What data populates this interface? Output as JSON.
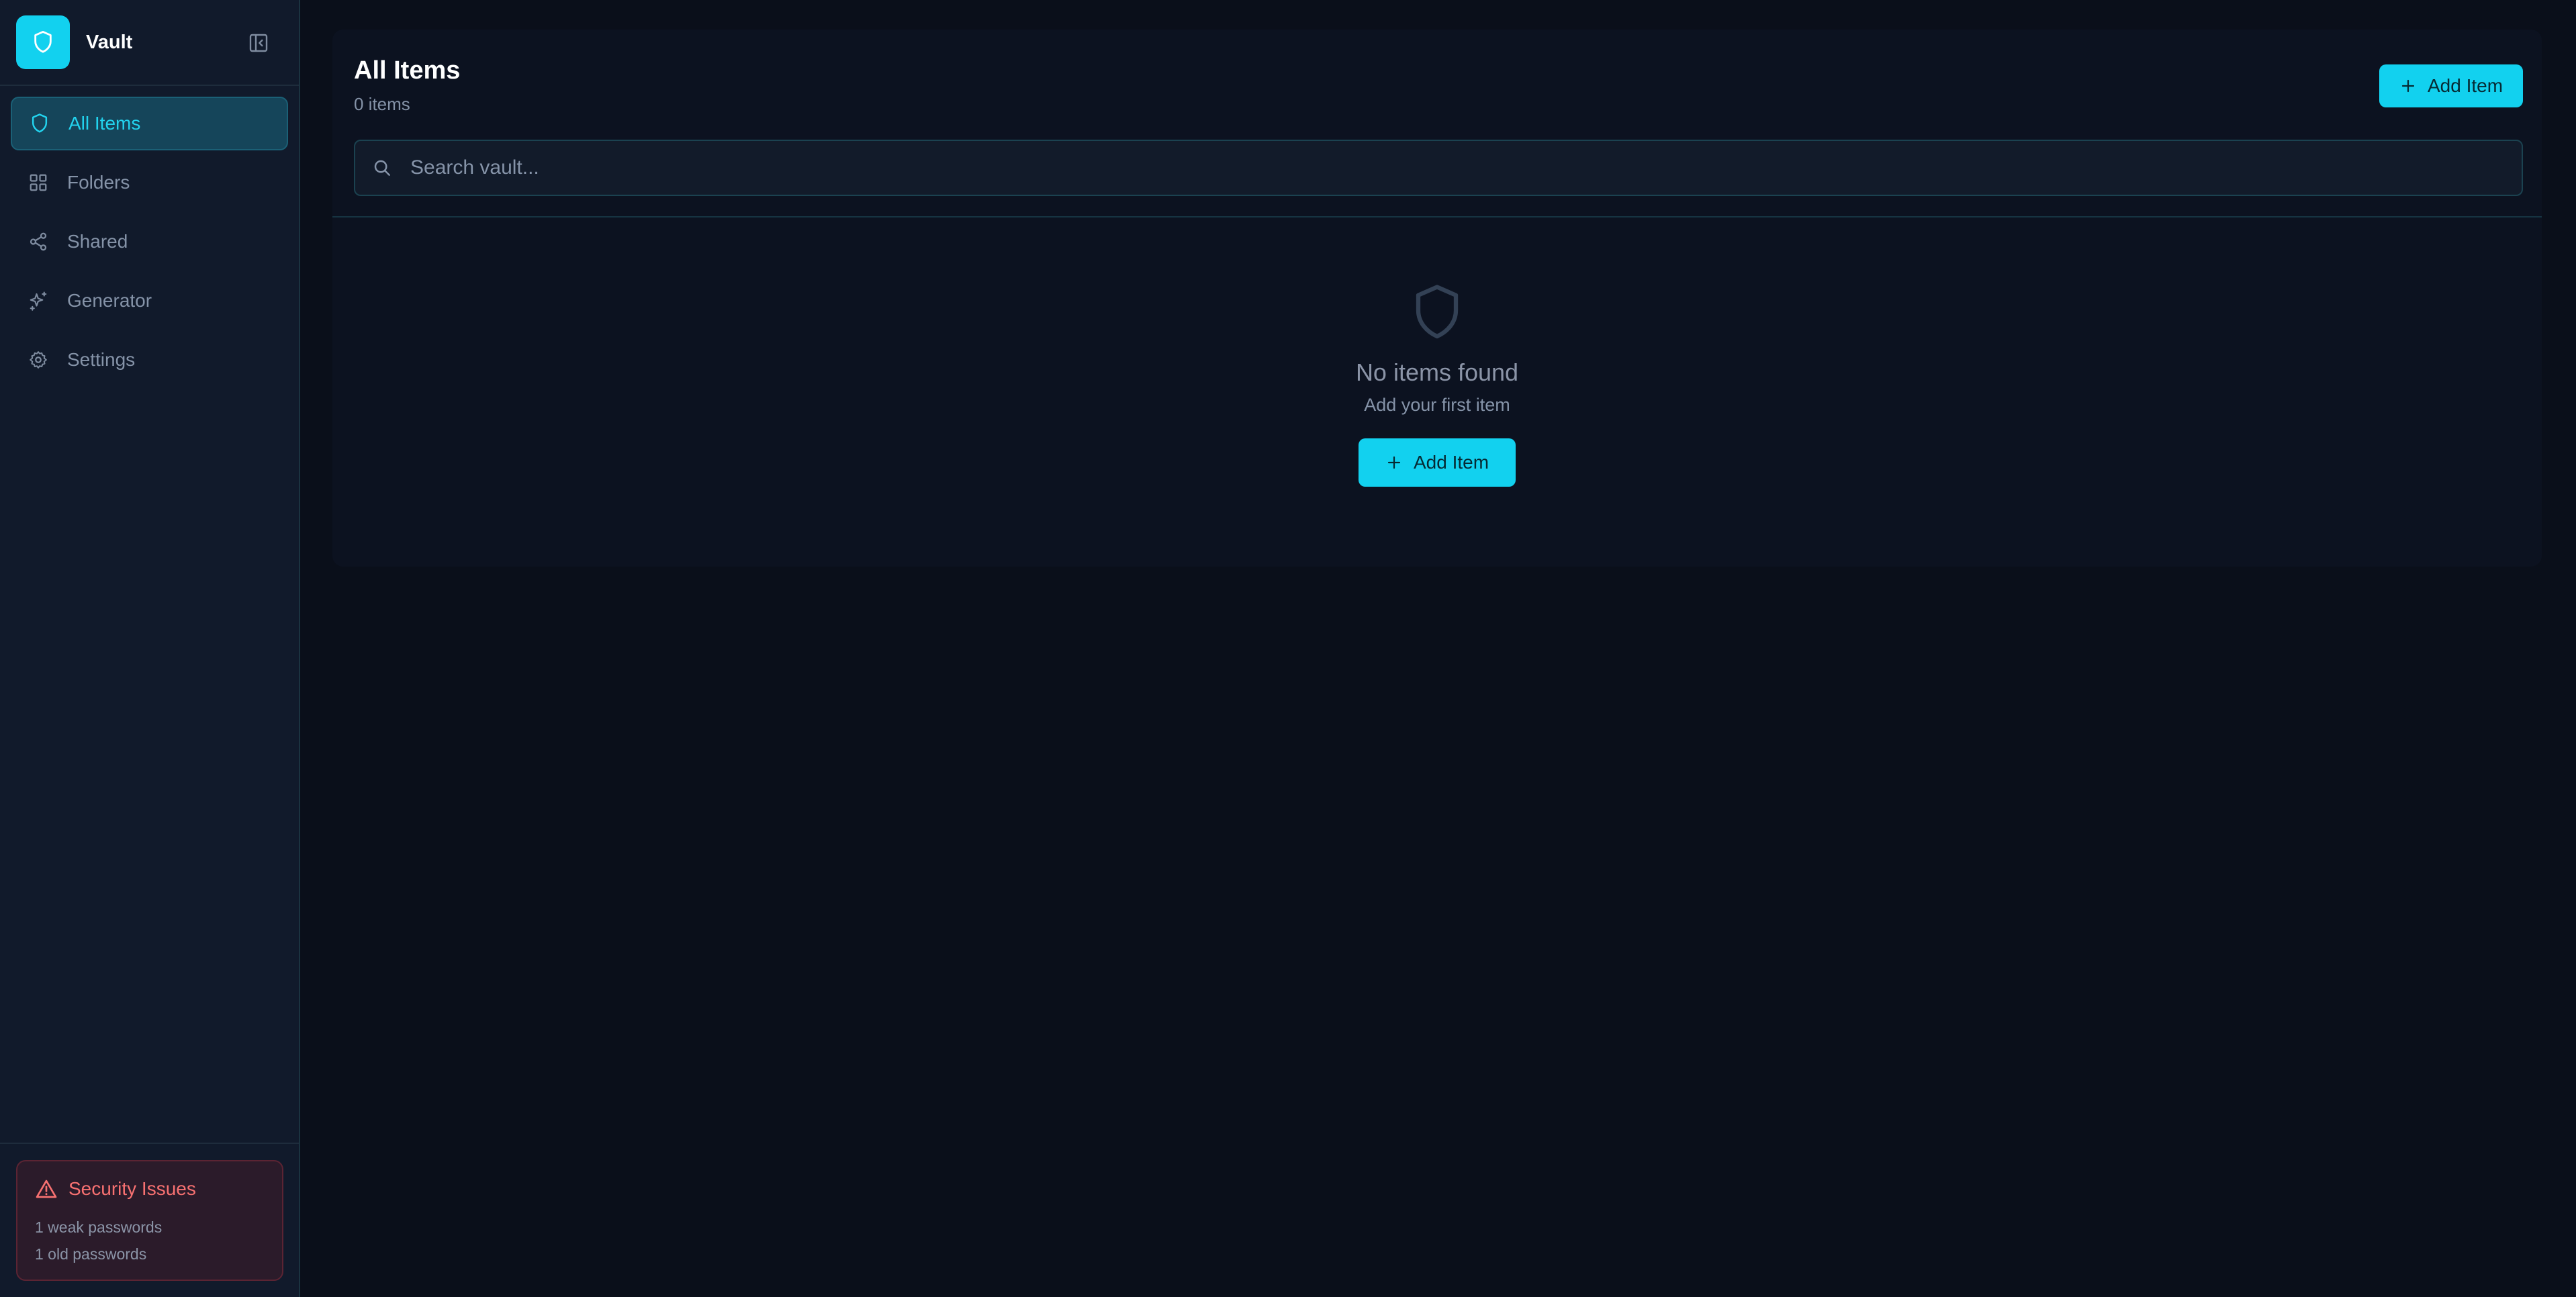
{
  "app": {
    "name": "Vault",
    "brand_color": "#12d1ef",
    "logo_icon": "shield-icon",
    "collapse_icon": "sidebar-collapse-icon"
  },
  "sidebar": {
    "items": [
      {
        "label": "All Items",
        "icon": "shield-icon",
        "active": true
      },
      {
        "label": "Folders",
        "icon": "grid-icon",
        "active": false
      },
      {
        "label": "Shared",
        "icon": "share-icon",
        "active": false
      },
      {
        "label": "Generator",
        "icon": "sparkles-icon",
        "active": false
      },
      {
        "label": "Settings",
        "icon": "gear-icon",
        "active": false
      }
    ],
    "security": {
      "title": "Security Issues",
      "icon": "warning-icon",
      "lines": [
        "1 weak passwords",
        "1 old passwords"
      ],
      "color": "#f87171"
    }
  },
  "main": {
    "title": "All Items",
    "count": "0 items",
    "add_button_label": "Add Item",
    "search_placeholder": "Search vault...",
    "search_value": "",
    "empty": {
      "icon": "shield-icon",
      "title": "No items found",
      "subtitle": "Add your first item",
      "button_label": "Add Item"
    }
  }
}
